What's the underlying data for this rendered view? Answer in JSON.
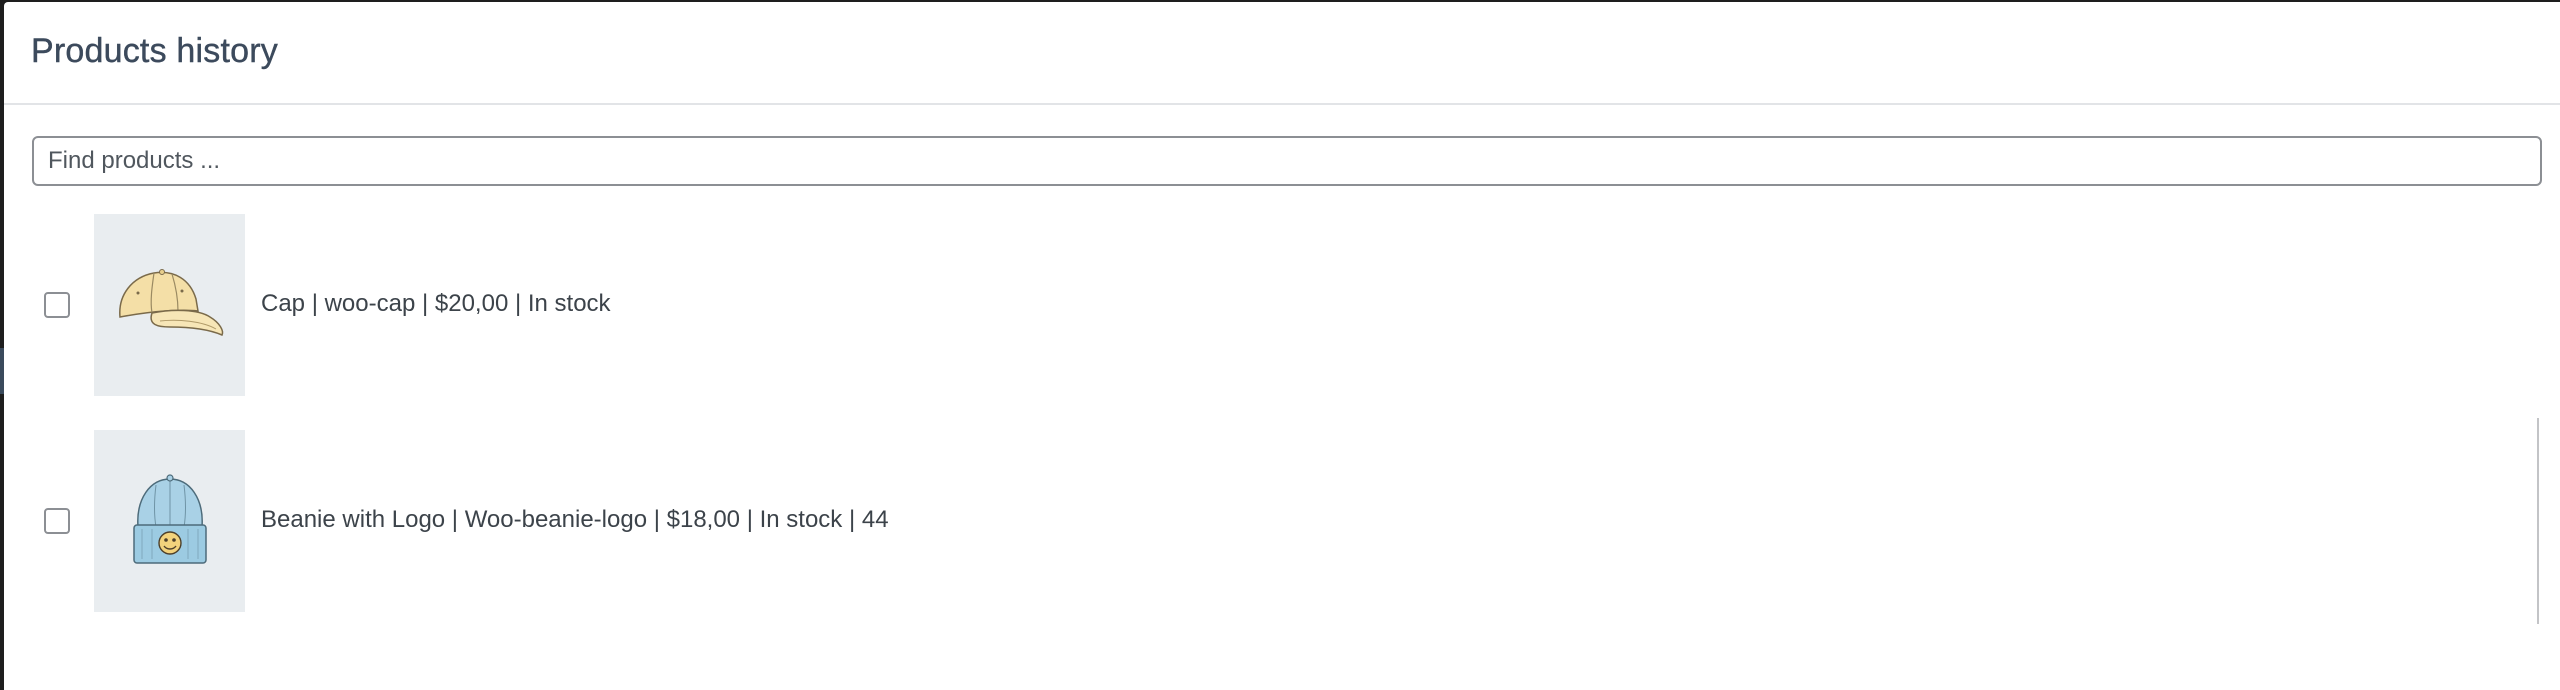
{
  "modal": {
    "title": "Products history"
  },
  "search": {
    "placeholder": "Find products ...",
    "value": ""
  },
  "products": [
    {
      "label": "Cap | woo-cap | $20,00 | In stock",
      "image_icon": "cap-icon",
      "checked": false
    },
    {
      "label": "Beanie with Logo | Woo-beanie-logo | $18,00 | In stock | 44",
      "image_icon": "beanie-icon",
      "checked": false
    }
  ],
  "colors": {
    "title": "#3c4a5c",
    "text": "#3c434a",
    "thumb_bg": "#e9edf0",
    "cap": "#f4dfa7",
    "beanie": "#a9d1e6"
  }
}
